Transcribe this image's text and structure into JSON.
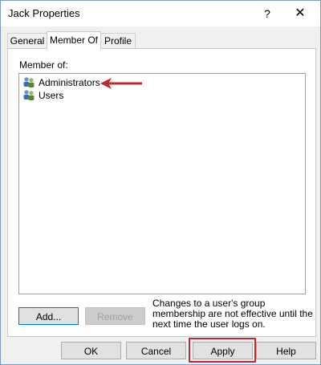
{
  "window": {
    "title": "Jack Properties",
    "help_glyph": "?",
    "close_glyph": "✕"
  },
  "tabs": [
    {
      "label": "General",
      "active": false
    },
    {
      "label": "Member Of",
      "active": true
    },
    {
      "label": "Profile",
      "active": false
    }
  ],
  "member_of": {
    "label": "Member of:",
    "items": [
      {
        "name": "Administrators",
        "icon": "group-icon"
      },
      {
        "name": "Users",
        "icon": "group-icon"
      }
    ],
    "annotation_color": "#c1272d"
  },
  "actions": {
    "add_label": "Add...",
    "remove_label": "Remove",
    "note": "Changes to a user's group membership are not effective until the next time the user logs on."
  },
  "footer": {
    "ok_label": "OK",
    "cancel_label": "Cancel",
    "apply_label": "Apply",
    "help_label": "Help"
  }
}
